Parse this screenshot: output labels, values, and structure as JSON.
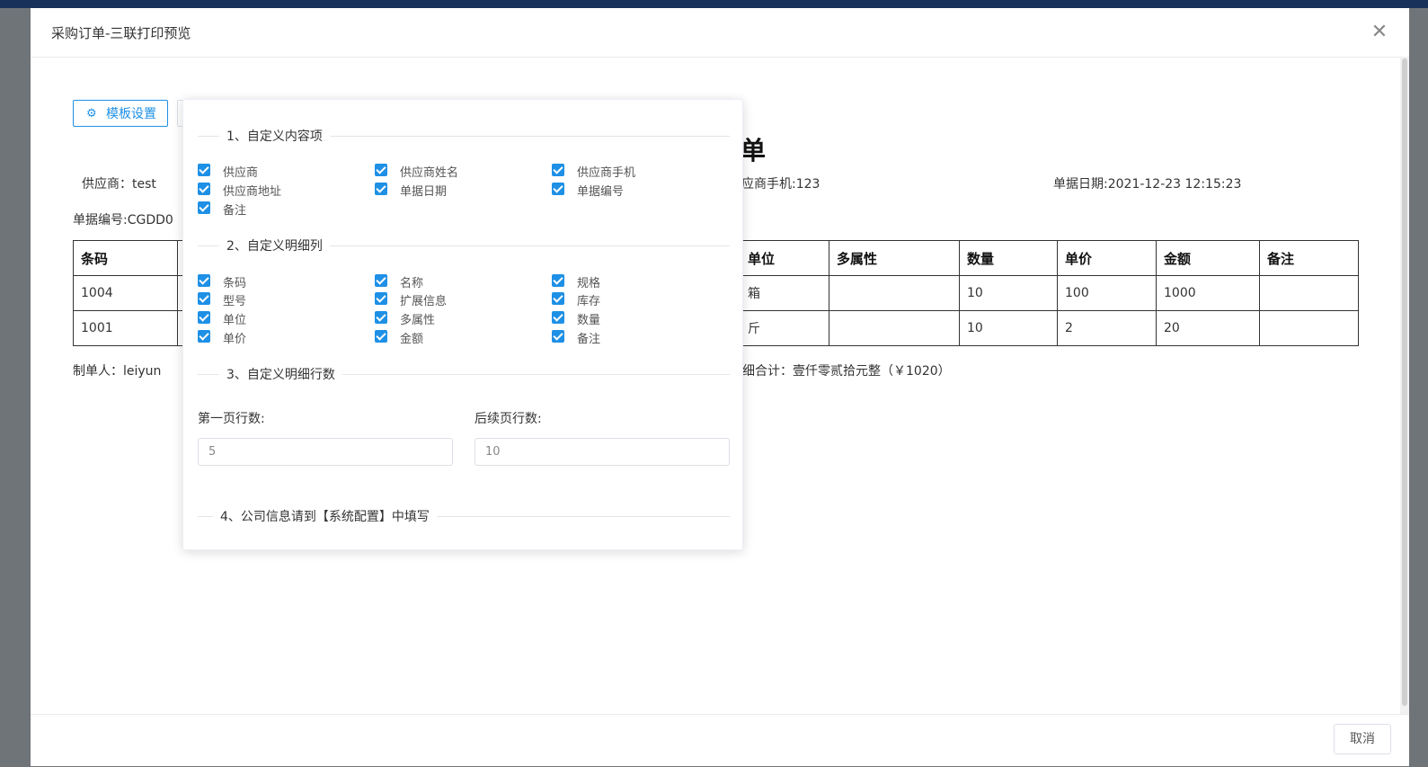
{
  "modal": {
    "title": "采购订单-三联打印预览",
    "cancel_label": "取消"
  },
  "toolbar": {
    "template_button_label": "模板设置"
  },
  "document": {
    "title_partial": "单",
    "supplier": "供应商：test",
    "supplier_phone_partial": "应商手机:123",
    "doc_date": "单据日期:2021-12-23 12:15:23",
    "doc_no_partial": "单据编号:CGDD0",
    "maker": "制单人：leiyun",
    "total_partial": "细合计：壹仟零贰拾元整（￥1020）",
    "headers": {
      "barcode": "条码",
      "unit": "单位",
      "attrs": "多属性",
      "qty": "数量",
      "price": "单价",
      "amount": "金额",
      "remark": "备注"
    },
    "rows": [
      {
        "barcode": "1004",
        "unit": "箱",
        "attrs": "",
        "qty": "10",
        "price": "100",
        "amount": "1000",
        "remark": ""
      },
      {
        "barcode": "1001",
        "unit": "斤",
        "attrs": "",
        "qty": "10",
        "price": "2",
        "amount": "20",
        "remark": ""
      }
    ]
  },
  "popover": {
    "sections": {
      "content": "1、自定义内容项",
      "columns": "2、自定义明细列",
      "rows": "3、自定义明细行数",
      "company": "4、公司信息请到【系统配置】中填写"
    },
    "content_items": [
      {
        "label": "供应商",
        "checked": true
      },
      {
        "label": "供应商姓名",
        "checked": true
      },
      {
        "label": "供应商手机",
        "checked": true
      },
      {
        "label": "供应商地址",
        "checked": true
      },
      {
        "label": "单据日期",
        "checked": true
      },
      {
        "label": "单据编号",
        "checked": true
      },
      {
        "label": "备注",
        "checked": true
      }
    ],
    "column_items": [
      {
        "label": "条码",
        "checked": true
      },
      {
        "label": "名称",
        "checked": true
      },
      {
        "label": "规格",
        "checked": true
      },
      {
        "label": "型号",
        "checked": true
      },
      {
        "label": "扩展信息",
        "checked": true
      },
      {
        "label": "库存",
        "checked": true
      },
      {
        "label": "单位",
        "checked": true
      },
      {
        "label": "多属性",
        "checked": true
      },
      {
        "label": "数量",
        "checked": true
      },
      {
        "label": "单价",
        "checked": true
      },
      {
        "label": "金额",
        "checked": true
      },
      {
        "label": "备注",
        "checked": true
      }
    ],
    "first_page_label": "第一页行数:",
    "first_page_value": "5",
    "next_page_label": "后续页行数:",
    "next_page_value": "10"
  },
  "colors": {
    "accent": "#1e90e6",
    "topbar": "#17315a"
  }
}
